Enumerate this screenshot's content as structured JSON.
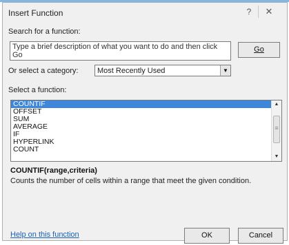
{
  "dialog": {
    "title": "Insert Function",
    "help_glyph": "?",
    "close_glyph": "✕"
  },
  "search": {
    "label": "Search for a function:",
    "text": "Type a brief description of what you want to do and then click Go",
    "go_label": "Go"
  },
  "category": {
    "label": "Or select a category:",
    "selected": "Most Recently Used"
  },
  "functions": {
    "label": "Select a function:",
    "items": [
      "COUNTIF",
      "OFFSET",
      "SUM",
      "AVERAGE",
      "IF",
      "HYPERLINK",
      "COUNT"
    ],
    "selected_index": 0
  },
  "details": {
    "signature": "COUNTIF(range,criteria)",
    "description": "Counts the number of cells within a range that meet the given condition."
  },
  "footer": {
    "help_link": "Help on this function",
    "ok_label": "OK",
    "cancel_label": "Cancel"
  }
}
